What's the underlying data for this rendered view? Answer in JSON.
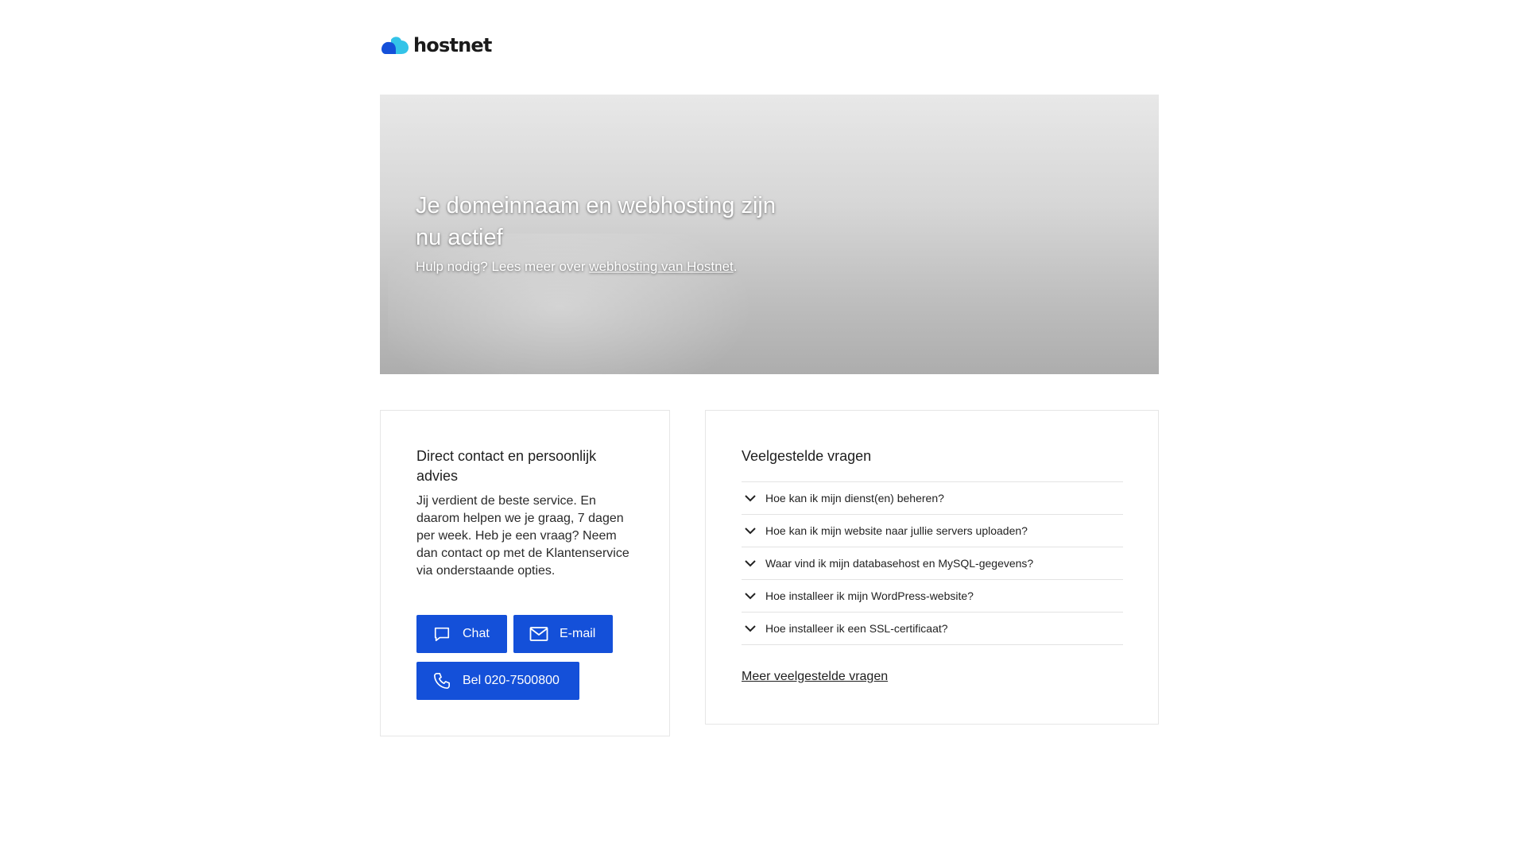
{
  "header": {
    "brand": "hostnet",
    "logo_colors": {
      "dark": "#1450d9",
      "light": "#33c3e8"
    }
  },
  "hero": {
    "title": "Je domeinnaam en webhosting zijn nu actief",
    "subtitle_prefix": "Hulp nodig? Lees meer over ",
    "subtitle_link": "webhosting van Hostnet",
    "subtitle_suffix": "."
  },
  "contact": {
    "title": "Direct contact en persoonlijk advies",
    "text": "Jij verdient de beste service. En daarom helpen we je graag, 7 dagen per week. Heb je een vraag? Neem dan contact op met de Klantenservice via onderstaande opties.",
    "buttons": {
      "chat": {
        "label": "Chat",
        "icon": "chat-bubble-icon"
      },
      "email": {
        "label": "E-mail",
        "icon": "mail-icon"
      },
      "call": {
        "label": "Bel 020-7500800",
        "icon": "phone-icon"
      }
    },
    "button_color": "#1450d9"
  },
  "faq": {
    "title": "Veelgestelde vragen",
    "items": [
      {
        "label": "Hoe kan ik mijn dienst(en) beheren?"
      },
      {
        "label": "Hoe kan ik mijn website naar jullie servers uploaden?"
      },
      {
        "label": "Waar vind ik mijn databasehost en MySQL-gegevens?"
      },
      {
        "label": "Hoe installeer ik mijn WordPress-website?"
      },
      {
        "label": "Hoe installeer ik een SSL-certificaat?"
      }
    ],
    "more_link": "Meer veelgestelde vragen"
  }
}
